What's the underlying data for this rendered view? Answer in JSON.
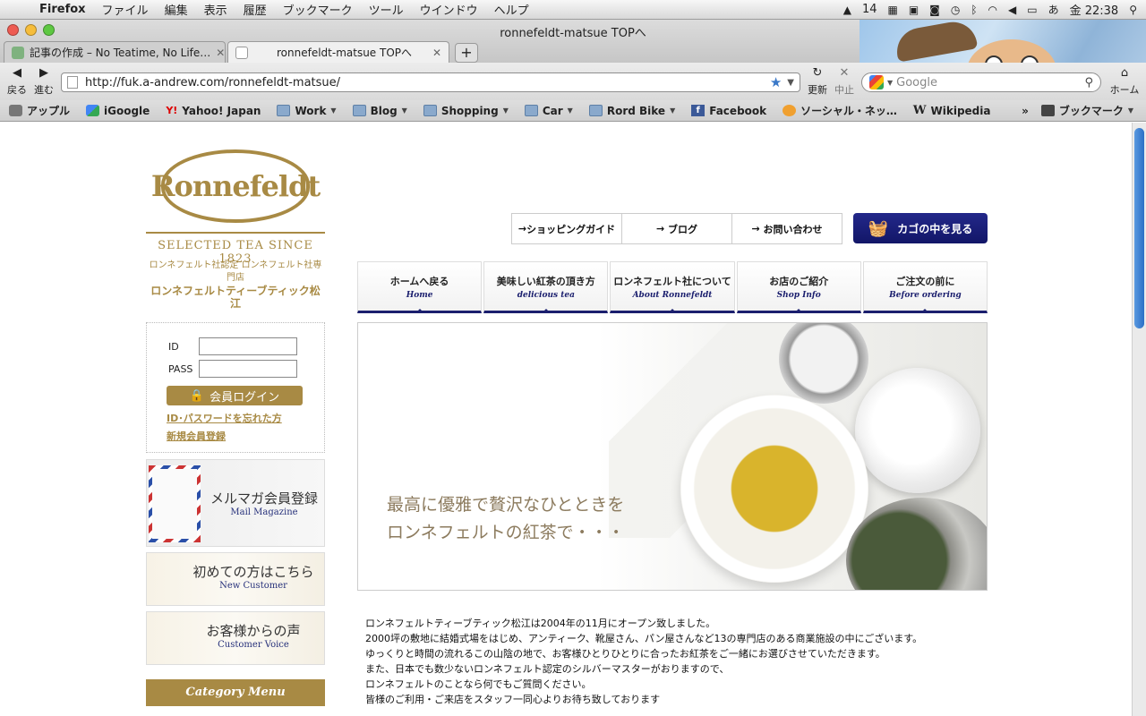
{
  "menubar": {
    "app": "Firefox",
    "items": [
      "ファイル",
      "編集",
      "表示",
      "履歴",
      "ブックマーク",
      "ツール",
      "ウインドウ",
      "ヘルプ"
    ],
    "status_count": "14",
    "clock": "金 22:38"
  },
  "window": {
    "title": "ronnefeldt-matsue TOPへ"
  },
  "tabs": [
    {
      "label": "記事の作成 – No Teatime, No Life…",
      "active": false
    },
    {
      "label": "ronnefeldt-matsue TOPへ",
      "active": true
    }
  ],
  "nav": {
    "back_label": "戻る",
    "forward_label": "進む",
    "reload_label": "更新",
    "stop_label": "中止",
    "home_label": "ホーム",
    "url": "http://fuk.a-andrew.com/ronnefeldt-matsue/",
    "search_placeholder": "Google"
  },
  "bookmarks": {
    "items": [
      "アップル",
      "iGoogle",
      "Yahoo! Japan",
      "Work",
      "Blog",
      "Shopping",
      "Car",
      "Rord Bike",
      "Facebook",
      "ソーシャル・ネッ…",
      "Wikipedia"
    ],
    "overflow": "»",
    "menu_label": "ブックマーク"
  },
  "site": {
    "logo_text": "Ronnefeldt",
    "tagline": "SELECTED TEA SINCE 1823",
    "subline_1": "ロンネフェルト社認定 ロンネフェルト社専門店",
    "subline_2": "ロンネフェルトティーブティック松江",
    "login": {
      "id_label": "ID",
      "pass_label": "PASS",
      "button": "会員ログイン",
      "forgot": "ID･パスワードを忘れた方",
      "register": "新規会員登録"
    },
    "banners": [
      {
        "jp": "メルマガ会員登録",
        "en": "Mail Magazine"
      },
      {
        "jp": "初めての方はこちら",
        "en": "New Customer"
      },
      {
        "jp": "お客様からの声",
        "en": "Customer Voice"
      }
    ],
    "category_title": "Category Menu",
    "util_nav": [
      "ショッピングガイド",
      "ブログ",
      "お問い合わせ"
    ],
    "cart_label": "カゴの中を見る",
    "main_nav": [
      {
        "jp": "ホームへ戻る",
        "en": "Home"
      },
      {
        "jp": "美味しい紅茶の頂き方",
        "en": "delicious tea"
      },
      {
        "jp": "ロンネフェルト社について",
        "en": "About Ronnefeldt"
      },
      {
        "jp": "お店のご紹介",
        "en": "Shop Info"
      },
      {
        "jp": "ご注文の前に",
        "en": "Before ordering"
      }
    ],
    "hero_copy_1": "最高に優雅で贅沢なひとときを",
    "hero_copy_2": "ロンネフェルトの紅茶で・・・",
    "intro": [
      "ロンネフェルトティーブティック松江は2004年の11月にオープン致しました。",
      "2000坪の敷地に結婚式場をはじめ、アンティーク、靴屋さん、パン屋さんなど13の専門店のある商業施設の中にございます。",
      "ゆっくりと時間の流れるこの山陰の地で、お客様ひとりひとりに合ったお紅茶をご一緒にお選びさせていただきます。",
      "また、日本でも数少ないロンネフェルト認定のシルバーマスターがおりますので、",
      "ロンネフェルトのことなら何でもご質問ください。",
      "皆様のご利用・ご来店をスタッフ一同心よりお待ち致しております"
    ]
  },
  "colors": {
    "gold": "#a88a44",
    "navy": "#1b1f6e",
    "scroll": "#2c6fc6"
  }
}
